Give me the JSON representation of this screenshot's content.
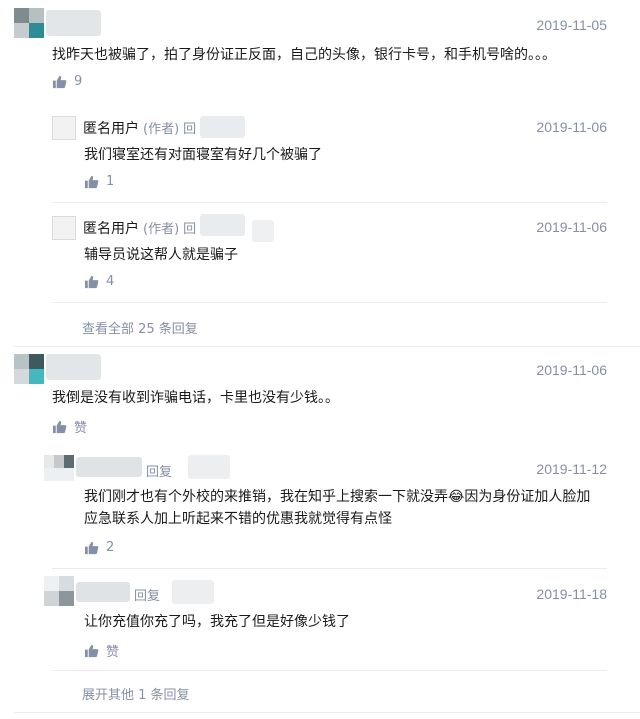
{
  "comments": [
    {
      "date": "2019-11-05",
      "text": "找昨天也被骗了，拍了身份证正反面，自己的头像，银行卡号，和手机号啥的。。。",
      "likes": "9",
      "replies": [
        {
          "name": "匿名用户",
          "author_tag": "(作者)",
          "reply_label": "回",
          "date": "2019-11-06",
          "text": "我们寝室还有对面寝室有好几个被骗了",
          "likes": "1"
        },
        {
          "name": "匿名用户",
          "author_tag": "(作者)",
          "reply_label": "回",
          "date": "2019-11-06",
          "text": "辅导员说这帮人就是骗子",
          "likes": "4"
        }
      ],
      "more_link": "查看全部 25 条回复"
    },
    {
      "date": "2019-11-06",
      "text": "我倒是没有收到诈骗电话，卡里也没有少钱。。",
      "likes": "赞",
      "replies": [
        {
          "reply_label": "回复",
          "date": "2019-11-12",
          "text_line1": "我们刚才也有个外校的来推销，我在知乎上搜索一下就没弄😂因为身份证加人脸加",
          "text_line2": "应急联系人加上听起来不错的优惠我就觉得有点怪",
          "likes": "2"
        },
        {
          "reply_label": "回复",
          "date": "2019-11-18",
          "text": "让你充值你充了吗，我充了但是好像少钱了",
          "likes": "赞"
        }
      ],
      "more_link": "展开其他 1 条回复"
    }
  ],
  "icons": {
    "like": "thumbs-up-icon"
  },
  "colors": {
    "meta": "#8590a6",
    "text": "#1a1a1a",
    "divider": "#ebebeb"
  }
}
